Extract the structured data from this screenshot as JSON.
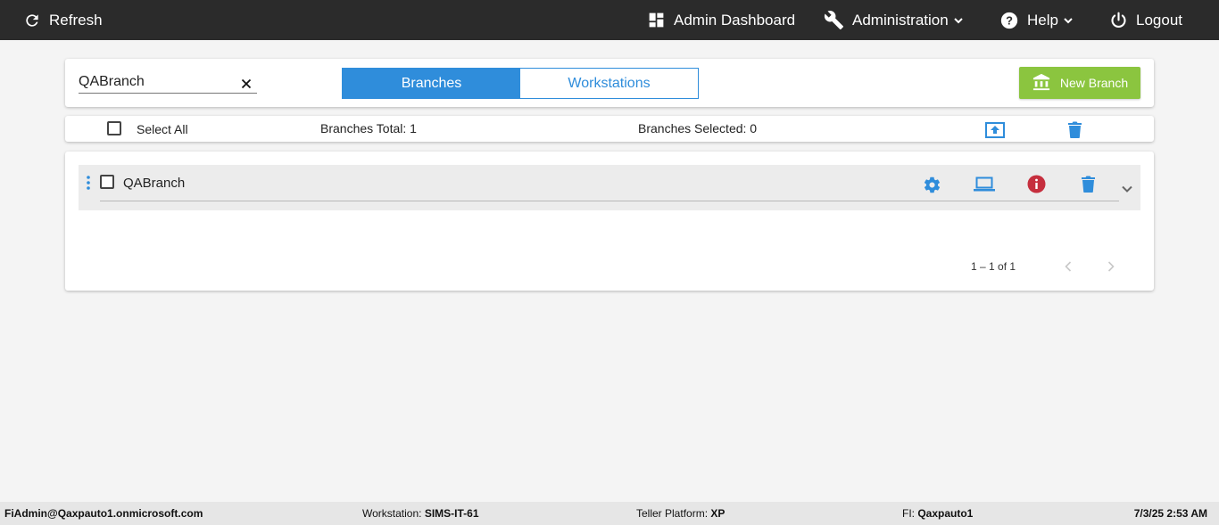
{
  "nav": {
    "refresh": "Refresh",
    "admin_dashboard": "Admin Dashboard",
    "administration": "Administration",
    "help": "Help",
    "logout": "Logout"
  },
  "search": {
    "value": "QABranch",
    "placeholder": ""
  },
  "tabs": [
    {
      "label": "Branches",
      "active": true
    },
    {
      "label": "Workstations",
      "active": false
    }
  ],
  "new_branch_label": "New Branch",
  "summary": {
    "select_all": "Select All",
    "total": "Branches Total: 1",
    "selected": "Branches Selected: 0"
  },
  "branches": [
    {
      "name": "QABranch",
      "checked": false
    }
  ],
  "pager": {
    "range": "1 – 1 of 1"
  },
  "footer": {
    "user": "FiAdmin@Qaxpauto1.onmicrosoft.com",
    "workstation_label": "Workstation: ",
    "workstation_value": "SIMS-IT-61",
    "platform_label": "Teller Platform: ",
    "platform_value": "XP",
    "fi_label": "FI: ",
    "fi_value": "Qaxpauto1",
    "datetime": "7/3/25 2:53 AM"
  },
  "colors": {
    "accent_blue": "#2f8ddb",
    "nav_bg": "#2b2b2b",
    "new_branch_green": "#8bc53f",
    "info_red": "#c62f3e"
  },
  "icons": [
    "refresh-icon",
    "dashboard-icon",
    "wrench-icon",
    "help-icon",
    "power-icon",
    "close-icon",
    "bank-icon",
    "upload-icon",
    "trash-icon",
    "kebab-icon",
    "gear-icon",
    "laptop-icon",
    "info-icon",
    "chevron-down-icon",
    "chevron-left-icon",
    "chevron-right-icon"
  ]
}
